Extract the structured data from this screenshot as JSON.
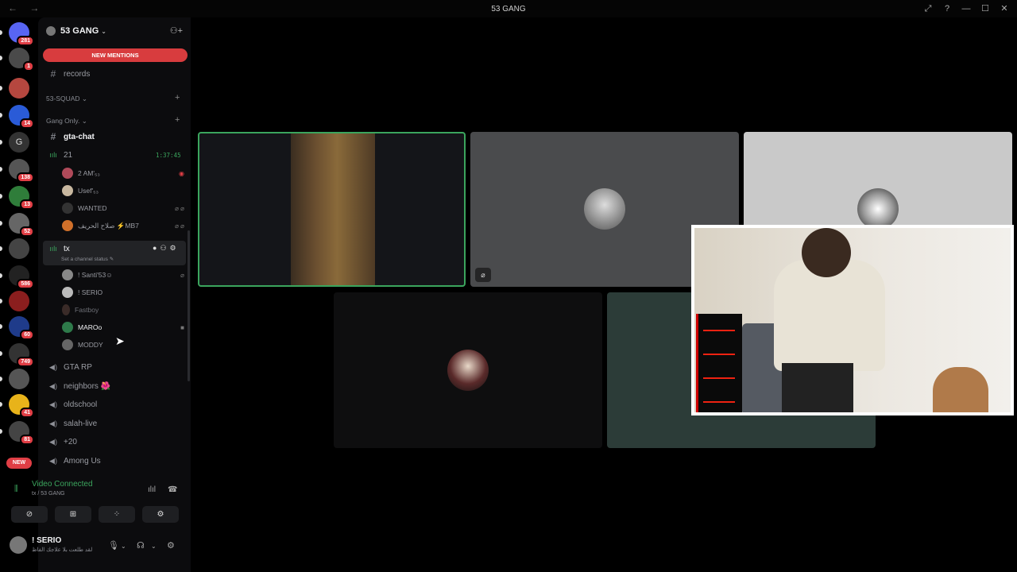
{
  "window": {
    "title": "53 GANG",
    "nav": "← →",
    "controls": [
      "⤢",
      "?",
      "—",
      "☐",
      "✕"
    ]
  },
  "guilds": [
    {
      "badge": "281",
      "color": "#5865f2"
    },
    {
      "badge": "1",
      "color": "#4a4a4a"
    },
    {
      "badge": "",
      "color": "#b5473f"
    },
    {
      "badge": "14",
      "color": "#2a5bd7"
    },
    {
      "badge": "",
      "color": "#333",
      "letter": "G"
    },
    {
      "badge": "138",
      "color": "#555"
    },
    {
      "badge": "13",
      "color": "#2f7d3a"
    },
    {
      "badge": "52",
      "color": "#666"
    },
    {
      "badge": "",
      "color": "#444"
    },
    {
      "badge": "586",
      "color": "#222"
    },
    {
      "badge": "",
      "color": "#8b1e1e"
    },
    {
      "badge": "60",
      "color": "#1f3b8a"
    },
    {
      "badge": "749",
      "color": "#333"
    },
    {
      "badge": "",
      "color": "#555"
    },
    {
      "badge": "41",
      "color": "#e8b31a"
    },
    {
      "badge": "81",
      "color": "#444"
    }
  ],
  "new_badge": "NEW",
  "server": {
    "name": "53 GANG",
    "new_mentions": "NEW MENTIONS"
  },
  "channels": {
    "records": "records",
    "cat_squad": "53-SQUAD",
    "cat_gang": "Gang Only.",
    "gta_chat": "gta-chat",
    "vc21": "21",
    "vc21_timer": "1:37:45",
    "vc21_users": [
      "2 AM'₅₃",
      "Usef'₅₃",
      "WANTED",
      "صلاح الحريف ⚡MB7"
    ],
    "tx": "tx",
    "tx_status": "Set a channel status ✎",
    "tx_users": [
      "! Santi'53☺",
      "! SERIO",
      "Fastboy",
      "MAROo",
      "MODDY"
    ],
    "others": [
      "GTA RP",
      "neighbors 🌺",
      "oldschool",
      "salah-live",
      "+20",
      "Among Us"
    ]
  },
  "voice": {
    "status": "Video Connected",
    "location": "tx / 53 GANG",
    "buttons": [
      "⊘",
      "⊞",
      "⁘",
      "⚙"
    ]
  },
  "user": {
    "name": "! SERIO",
    "status": "لقد طلعت بلا علاجك الفاظ"
  },
  "tiles": [
    {
      "kind": "camera",
      "speaking": true
    },
    {
      "kind": "avatar",
      "muted": true
    },
    {
      "kind": "avatar"
    },
    {
      "kind": "avatar"
    },
    {
      "kind": "blank"
    }
  ]
}
